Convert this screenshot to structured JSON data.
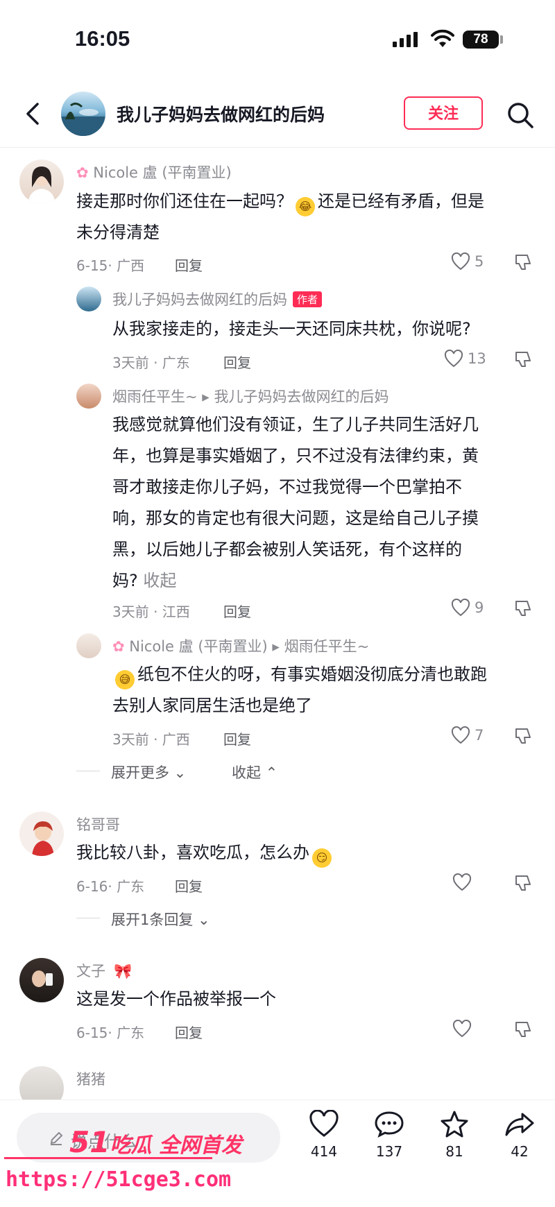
{
  "status_bar": {
    "time": "16:05",
    "battery": "78"
  },
  "header": {
    "title": "我儿子妈妈去做网红的后妈",
    "follow_label": "关注"
  },
  "comments": [
    {
      "name": "Nicole 盧 (平南置业)",
      "text_lines": [
        "接走那时你们还住在一起吗？",
        "还是已经有矛盾，但是",
        "未分得清楚"
      ],
      "meta": "6-15· 广西",
      "reply": "回复",
      "likes": "5",
      "replies": [
        {
          "name": "我儿子妈妈去做网红的后妈",
          "tag": "作者",
          "text_lines": [
            "从我家接走的，接走头一天还同床共枕，你说呢?"
          ],
          "meta": "3天前 · 广东",
          "reply": "回复",
          "likes": "13"
        },
        {
          "name": "烟雨任平生~ ▸ 我儿子妈妈去做网红的后妈",
          "text_lines": [
            "我感觉就算他们没有领证，生了儿子共同生活好几",
            "年，也算是事实婚姻了，只不过没有法律约束，黄",
            "哥才敢接走你儿子妈，不过我觉得一个巴掌拍不",
            "响，那女的肯定也有很大问题，这是给自己儿子摸",
            "黑，以后她儿子都会被别人笑话死，有个这样的",
            "妈?"
          ],
          "collapse": "收起",
          "meta": "3天前 · 江西",
          "reply": "回复",
          "likes": "9"
        },
        {
          "name": "Nicole 盧 (平南置业) ▸ 烟雨任平生~",
          "text_lines": [
            "纸包不住火的呀，有事实婚姻没彻底分清也敢跑",
            "去别人家同居生活也是绝了"
          ],
          "meta": "3天前 · 广西",
          "reply": "回复",
          "likes": "7"
        }
      ],
      "expand_more": "展开更多",
      "collapse": "收起"
    },
    {
      "name": "铭哥哥",
      "text_lines": [
        "我比较八卦，喜欢吃瓜，怎么办"
      ],
      "meta": "6-16· 广东",
      "reply": "回复",
      "expand": "展开1条回复"
    },
    {
      "name": "文子",
      "text_lines": [
        "这是发一个作品被举报一个"
      ],
      "meta": "6-15· 广东",
      "reply": "回复"
    },
    {
      "name": "猪猪"
    }
  ],
  "bottom_bar": {
    "input_placeholder": "说点什么",
    "likes": "414",
    "comments": "137",
    "favorites": "81",
    "shares": "42"
  },
  "watermark": {
    "brand_num": "51",
    "brand_text": "吃瓜 全网首发",
    "url": "https://51cge3.com"
  },
  "colors": {
    "accent": "#fe2c55",
    "meta_gray": "#8a8b91",
    "watermark": "#ff3366"
  }
}
